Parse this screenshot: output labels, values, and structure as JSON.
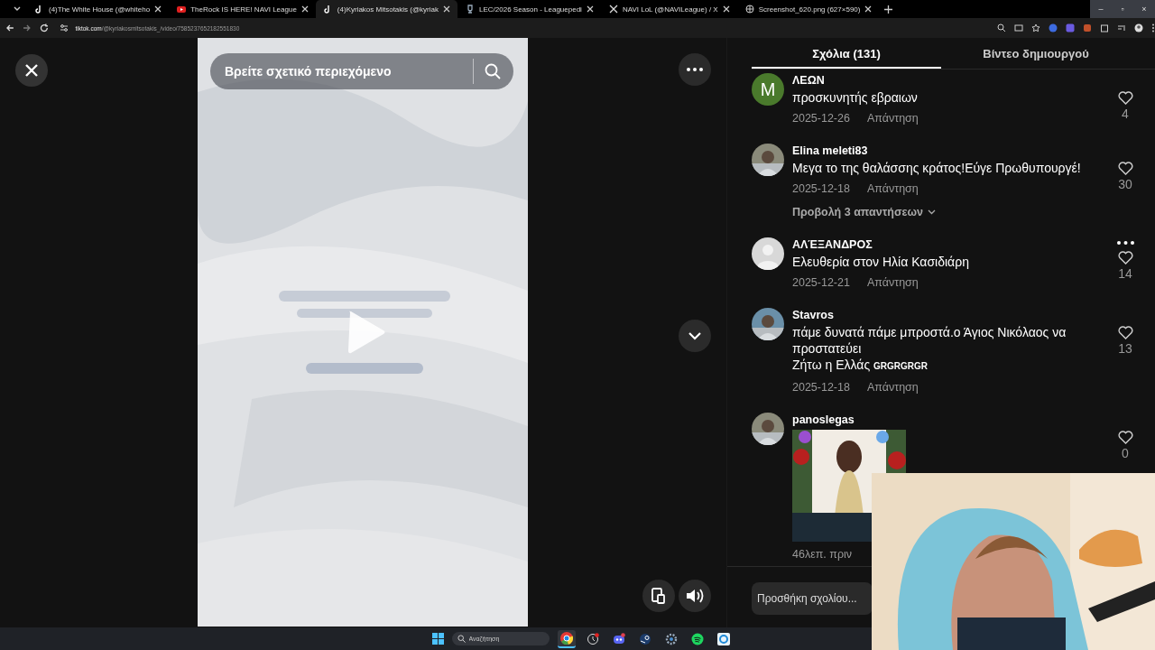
{
  "browser": {
    "tabs": [
      {
        "title": "(4)The White House (@whiteho",
        "selected": false
      },
      {
        "title": "TheRock IS HERE! NAVI League",
        "selected": false
      },
      {
        "title": "(4)Kyriakos Mitsotakis (@kyriak",
        "selected": true
      },
      {
        "title": "LEC/2026 Season - Leaguepedi",
        "selected": false
      },
      {
        "title": "NAVI LoL (@NAVILeague) / X",
        "selected": false
      },
      {
        "title": "Screenshot_620.png (627×590)",
        "selected": false
      }
    ],
    "window_controls": [
      "–",
      "▫",
      "×"
    ],
    "url_host": "tiktok.com",
    "url_path": "/@kyriakosmitsotakis_/video/7585237652182551830"
  },
  "video": {
    "kind": "picture",
    "search_placeholder": "Βρείτε σχετικό περιεχόμενο"
  },
  "panel": {
    "tabs": [
      {
        "label": "Σχόλια (131)",
        "selected": true
      },
      {
        "label": "Βίντεο δημιουργού",
        "selected": false
      }
    ],
    "comments": [
      {
        "kind": "letter",
        "initial": "M",
        "color": "#4a7a2c",
        "user": "ΛΕΩΝ",
        "text": "προσκυνητής εβραιων",
        "date": "2025-12-26",
        "reply": "Απάντηση",
        "likes": "4"
      },
      {
        "user": "Elina meleti83",
        "text": "Μεγα το της θαλάσσης κράτος!Εύγε Πρωθυπουργέ!",
        "date": "2025-12-18",
        "reply": "Απάντηση",
        "likes": "30",
        "replies_link": "Προβολή 3 απαντήσεων"
      },
      {
        "kind": "default",
        "user": "ΑΛΈΞΑΝΔΡΟΣ",
        "text": "Ελευθερία στον Ηλία Κασιδιάρη",
        "date": "2025-12-21",
        "reply": "Απάντηση",
        "likes": "14",
        "menu": true
      },
      {
        "user": "Stavros",
        "text": "πάμε δυνατά πάμε μπροστά.ο Άγιος Νικόλαος να προστατεύει\nΖήτω η Ελλάς",
        "tag": "GRGRGRGR",
        "date": "2025-12-18",
        "reply": "Απάντηση",
        "likes": "13"
      },
      {
        "user": "panoslegas",
        "date": "46λεπ. πριν",
        "likes": "0"
      }
    ],
    "comment_placeholder": "Προσθήκη σχολίου..."
  },
  "taskbar": {
    "search_placeholder": "Αναζήτηση",
    "apps": [
      {
        "kind": "chrome",
        "selected": true
      },
      {
        "kind": "clock",
        "selected": false
      },
      {
        "kind": "discord",
        "selected": false
      },
      {
        "kind": "steam",
        "selected": false
      },
      {
        "kind": "gear",
        "selected": false
      },
      {
        "kind": "spotify",
        "selected": false
      },
      {
        "kind": "ring",
        "selected": false
      }
    ]
  }
}
